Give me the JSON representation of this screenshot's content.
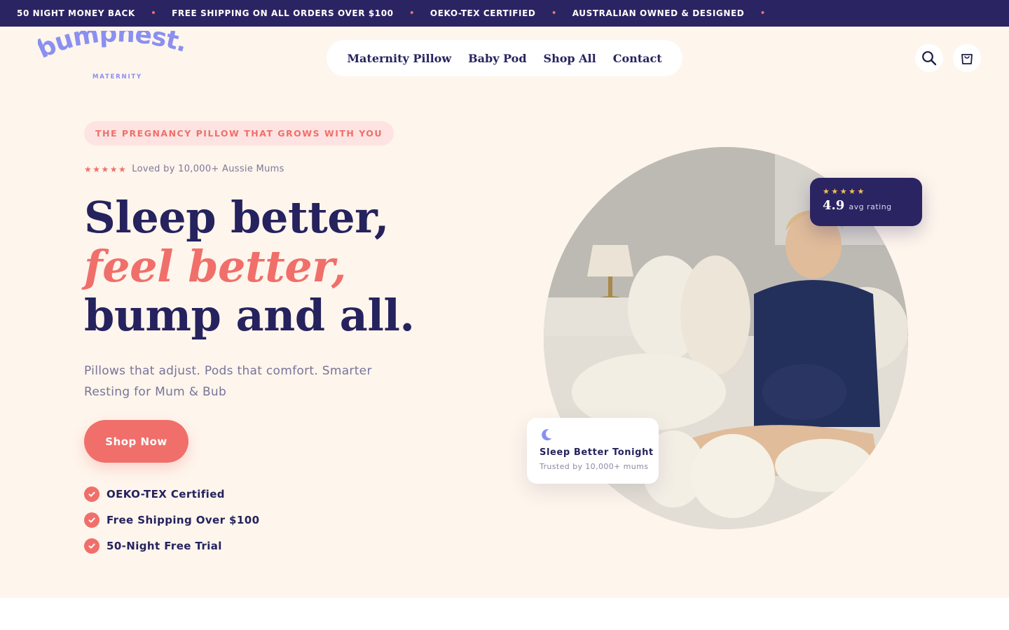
{
  "announcement": {
    "items": [
      "50 NIGHT MONEY BACK",
      "FREE SHIPPING ON ALL ORDERS OVER $100",
      "OEKO-TEX CERTIFIED",
      "AUSTRALIAN OWNED & DESIGNED"
    ],
    "separator": "•"
  },
  "header": {
    "logo_text": "bumpnest.",
    "logo_sub": "MATERNITY",
    "nav": [
      "Maternity Pillow",
      "Baby Pod",
      "Shop All",
      "Contact"
    ],
    "search_icon": "search-icon",
    "cart_icon": "cart-icon"
  },
  "hero": {
    "eyebrow": "THE PREGNANCY PILLOW THAT GROWS WITH YOU",
    "loved_stars": "★★★★★",
    "loved_text": "Loved by 10,000+ Aussie Mums",
    "headline": {
      "part1": "Sleep better, ",
      "accent": "feel better,",
      "part2": " bump and all."
    },
    "subhead": "Pillows that adjust. Pods that comfort. Smarter Resting for Mum & Bub",
    "cta": "Shop Now",
    "features": [
      "OEKO-TEX Certified",
      "Free Shipping Over $100",
      "50-Night Free Trial"
    ]
  },
  "rating_card": {
    "stars": "★★★★★",
    "value": "4.9",
    "label": "avg rating"
  },
  "sleep_card": {
    "icon": "moon-icon",
    "title": "Sleep Better Tonight",
    "subtitle": "Trusted by 10,000+ mums"
  },
  "colors": {
    "navy": "#2b2463",
    "coral": "#f06f6a",
    "cream": "#fef5ec",
    "periwinkle": "#8a8ff0"
  }
}
